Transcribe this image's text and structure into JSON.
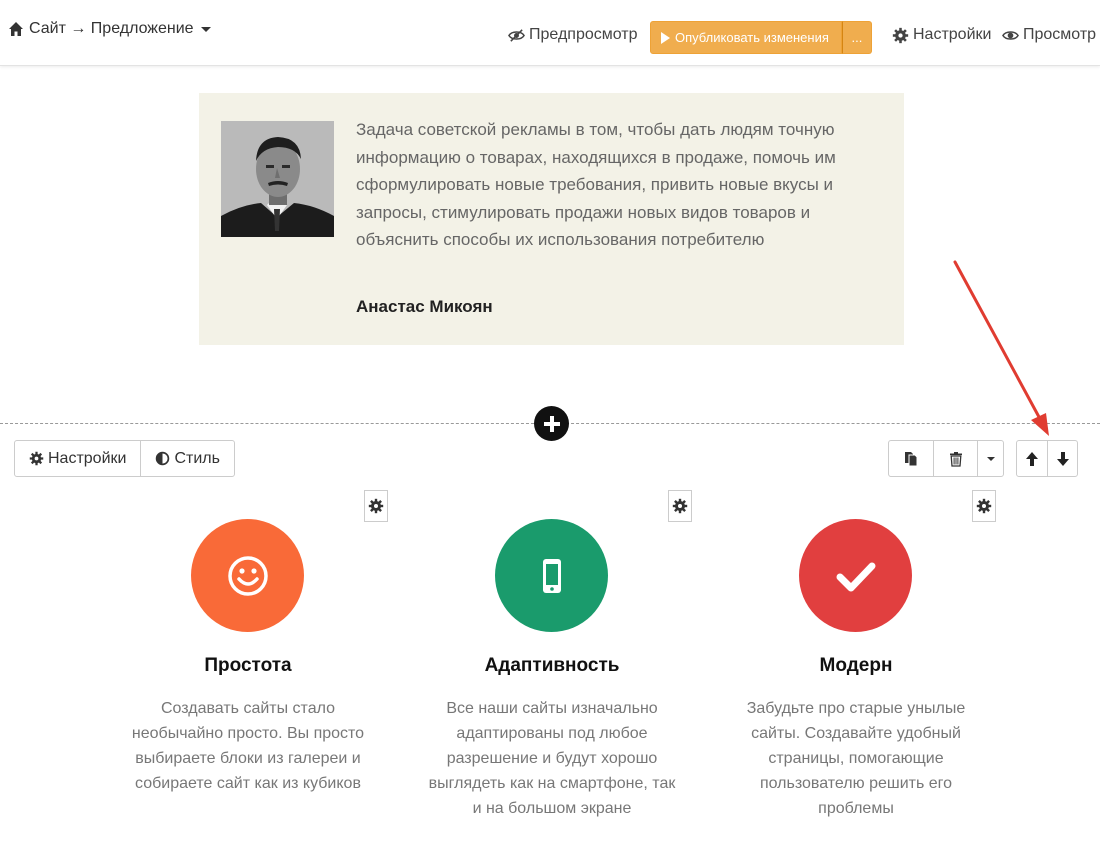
{
  "header": {
    "breadcrumb": "Сайт → Предложение",
    "preview_label": "Предпросмотр",
    "publish_label": "Опубликовать изменения",
    "publish_more_label": "...",
    "settings_label": "Настройки",
    "view_label": "Просмотр"
  },
  "quote": {
    "text": "Задача советской рекламы в том, чтобы дать людям точную информацию о товарах, находящихся в продаже, помочь им сформулировать новые требования, привить новые вкусы и запросы, стимулировать продажи новых видов товаров и объяснить способы их использования потребителю",
    "author": "Анастас Микоян"
  },
  "block_toolbar": {
    "settings_label": "Настройки",
    "style_label": "Стиль"
  },
  "features": [
    {
      "title": "Простота",
      "text": "Создавать сайты стало необычайно просто. Вы просто выбираете блоки из галереи и собираете сайт как из кубиков",
      "color": "#f96a38",
      "icon": "smile-icon"
    },
    {
      "title": "Адаптивность",
      "text": "Все наши сайты изначально адаптированы под любое разрешение и будут хорошо выглядеть как на смартфоне, так и на большом экране",
      "color": "#1a9b6c",
      "icon": "mobile-icon"
    },
    {
      "title": "Модерн",
      "text": "Забудьте про старые унылые сайты. Создавайте удобный страницы, помогающие пользователю решить его проблемы",
      "color": "#e13f3f",
      "icon": "check-icon"
    }
  ],
  "colors": {
    "publish": "#f0ad4e",
    "quote_bg": "#f3f2e7",
    "annotation_arrow": "#e03c31"
  }
}
